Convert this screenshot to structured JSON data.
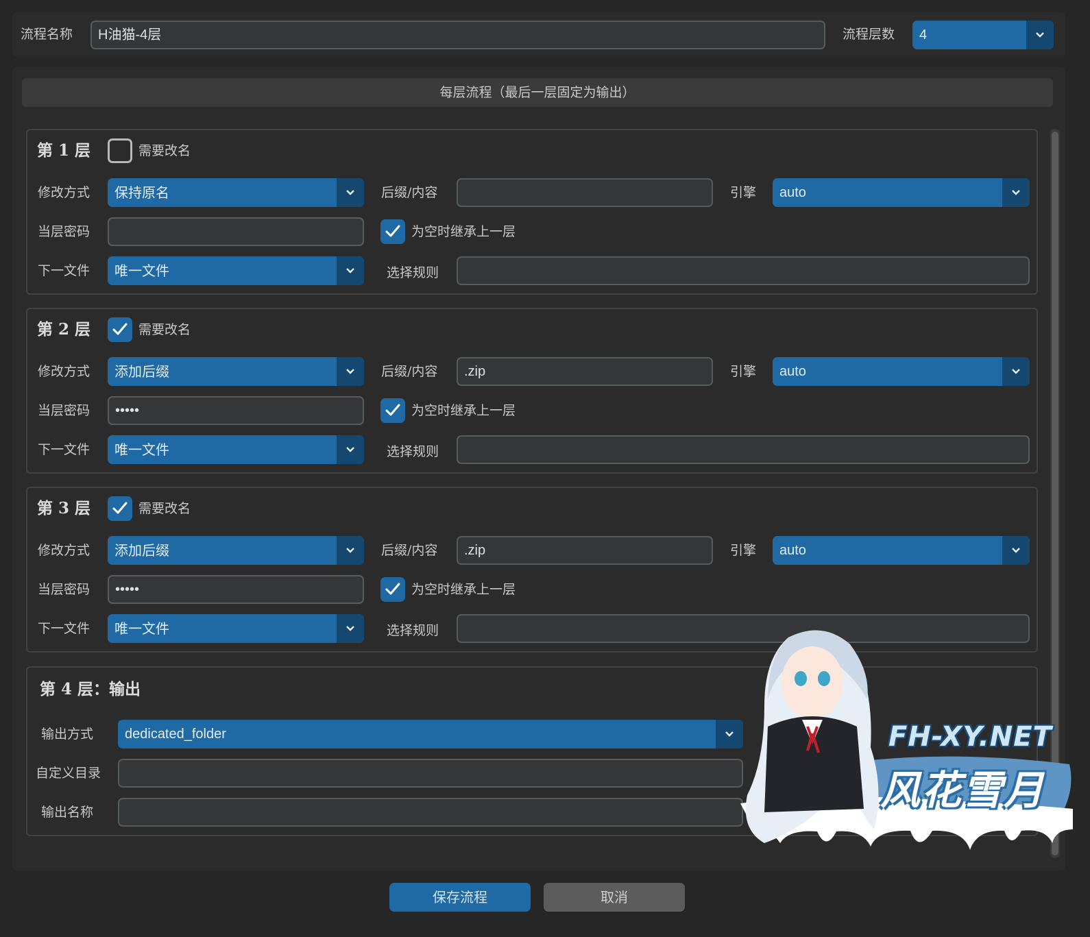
{
  "top": {
    "name_label": "流程名称",
    "name_value": "H油猫-4层",
    "count_label": "流程层数",
    "count_value": "4"
  },
  "section_header": "每层流程（最后一层固定为输出）",
  "layer_labels": {
    "mode": "修改方式",
    "suffix": "后缀/内容",
    "engine": "引擎",
    "password": "当层密码",
    "inherit": "为空时继承上一层",
    "next_file": "下一文件",
    "rule": "选择规则",
    "rename": "需要改名"
  },
  "layers": [
    {
      "title": "第 1 层",
      "rename_checked": false,
      "mode": "保持原名",
      "suffix": "",
      "engine": "auto",
      "password": "",
      "inherit_checked": true,
      "next_file": "唯一文件",
      "rule": ""
    },
    {
      "title": "第 2 层",
      "rename_checked": true,
      "mode": "添加后缀",
      "suffix": ".zip",
      "engine": "auto",
      "password": "•••••",
      "inherit_checked": true,
      "next_file": "唯一文件",
      "rule": ""
    },
    {
      "title": "第 3 层",
      "rename_checked": true,
      "mode": "添加后缀",
      "suffix": ".zip",
      "engine": "auto",
      "password": "•••••",
      "inherit_checked": true,
      "next_file": "唯一文件",
      "rule": ""
    }
  ],
  "output": {
    "title": "第 4 层：输出",
    "method_label": "输出方式",
    "method_value": "dedicated_folder",
    "dir_label": "自定义目录",
    "dir_value": "",
    "name_label": "输出名称",
    "name_value": ""
  },
  "buttons": {
    "save": "保存流程",
    "cancel": "取消"
  },
  "watermark": {
    "en": "FH-XY.NET",
    "cn": "风花雪月"
  },
  "colors": {
    "accent": "#1f6aa5",
    "accent_dark": "#144870",
    "bg": "#262626",
    "panel": "#2b2b2b"
  }
}
